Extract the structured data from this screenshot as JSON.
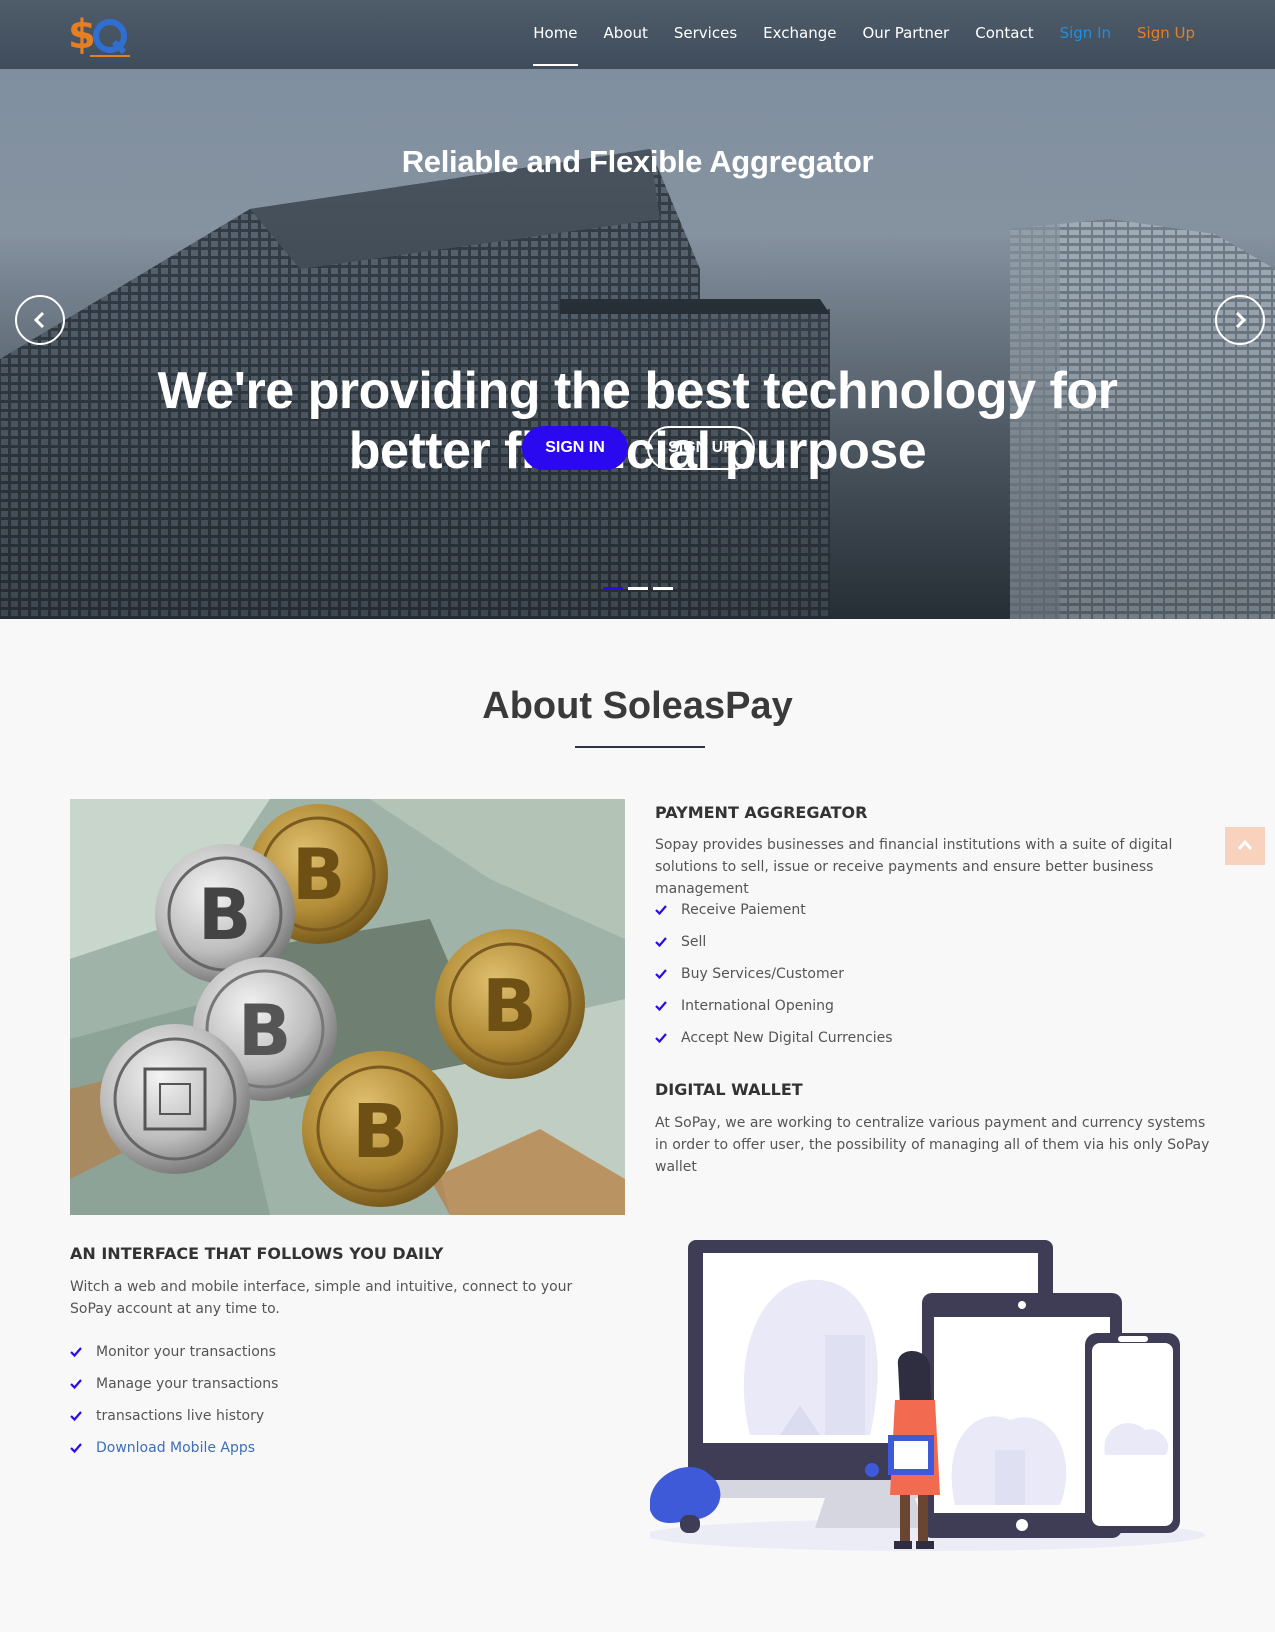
{
  "header": {
    "logo_alt": "SoPay",
    "nav": [
      {
        "label": "Home",
        "active": true
      },
      {
        "label": "About"
      },
      {
        "label": "Services"
      },
      {
        "label": "Exchange"
      },
      {
        "label": "Our Partner"
      },
      {
        "label": "Contact"
      },
      {
        "label": "Sign In"
      },
      {
        "label": "Sign Up"
      }
    ]
  },
  "hero": {
    "title": "Reliable and Flexible Aggregator",
    "headline": "We're providing the best technology for better financial purpose",
    "signin_label": "SIGN IN",
    "signup_label": "SIGN UP",
    "slide_count": 3,
    "active_slide": 1
  },
  "about": {
    "title": "About SoleasPay",
    "payment": {
      "heading": "PAYMENT AGGREGATOR",
      "text": "Sopay provides businesses and financial institutions with a suite of digital solutions to sell, issue or receive payments and ensure better business management",
      "items": [
        "Receive Paiement",
        "Sell",
        "Buy Services/Customer",
        "International Opening",
        "Accept New Digital Currencies"
      ]
    },
    "wallet": {
      "heading": "DIGITAL WALLET",
      "text": "At SoPay, we are working to centralize various payment and currency systems in order to offer user, the possibility of managing all of them via his only SoPay wallet"
    },
    "interface": {
      "heading": "AN INTERFACE THAT FOLLOWS YOU DAILY",
      "text": "Witch a web and mobile interface, simple and intuitive, connect to your SoPay account at any time to.",
      "items": [
        "Monitor your transactions",
        "Manage your transactions",
        "transactions live history",
        "Download Mobile Apps"
      ]
    }
  },
  "colors": {
    "accent": "#2b09f0",
    "signin_nav": "#1f8ee0",
    "signup_nav": "#e67e22",
    "link": "#3d6fb6"
  }
}
